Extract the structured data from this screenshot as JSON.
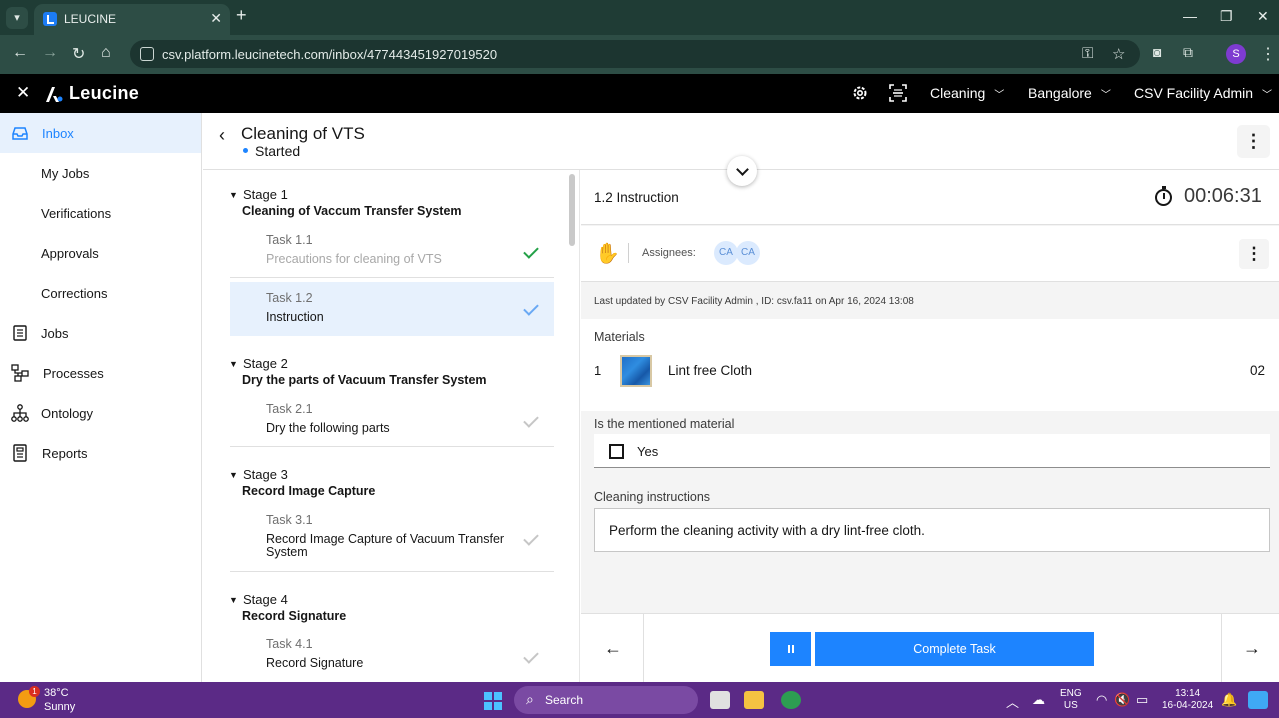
{
  "browser": {
    "tab_title": "LEUCINE",
    "url": "csv.platform.leucinetech.com/inbox/477443451927019520",
    "profile_initial": "S"
  },
  "app": {
    "logo_text": "Leucine",
    "dropdowns": {
      "use_case": "Cleaning",
      "facility": "Bangalore",
      "role": "CSV Facility Admin"
    },
    "icons": [
      "settings-icon",
      "scan-icon"
    ]
  },
  "sidebar": {
    "items": [
      {
        "label": "Inbox",
        "icon": "inbox-icon",
        "active": true
      },
      {
        "label": "My Jobs"
      },
      {
        "label": "Verifications"
      },
      {
        "label": "Approvals"
      },
      {
        "label": "Corrections"
      },
      {
        "label": "Jobs",
        "icon": "jobs-icon"
      },
      {
        "label": "Processes",
        "icon": "processes-icon"
      },
      {
        "label": "Ontology",
        "icon": "ontology-icon"
      },
      {
        "label": "Reports",
        "icon": "reports-icon"
      }
    ]
  },
  "job": {
    "title": "Cleaning of VTS",
    "status": "Started"
  },
  "stages": [
    {
      "label": "Stage 1",
      "name": "Cleaning of Vaccum Transfer System",
      "tasks": [
        {
          "label": "Task 1.1",
          "name": "Precautions for cleaning of VTS",
          "state": "done"
        },
        {
          "label": "Task 1.2",
          "name": "Instruction",
          "state": "active"
        }
      ]
    },
    {
      "label": "Stage 2",
      "name": "Dry the parts of Vacuum Transfer System",
      "tasks": [
        {
          "label": "Task 2.1",
          "name": "Dry the following parts",
          "state": "pending"
        }
      ]
    },
    {
      "label": "Stage 3",
      "name": "Record Image Capture",
      "tasks": [
        {
          "label": "Task 3.1",
          "name": "Record Image Capture of Vacuum Transfer System",
          "state": "pending"
        }
      ]
    },
    {
      "label": "Stage 4",
      "name": "Record Signature",
      "tasks": [
        {
          "label": "Task 4.1",
          "name": "Record Signature",
          "state": "pending"
        }
      ]
    }
  ],
  "task_detail": {
    "title": "1.2 Instruction",
    "timer": "00:06:31",
    "assignees_label": "Assignees:",
    "assignees": [
      "CA",
      "CA"
    ],
    "last_updated": "Last updated by CSV Facility Admin , ID: csv.fa11 on Apr 16, 2024 13:08",
    "materials_label": "Materials",
    "materials": [
      {
        "index": "1",
        "name": "Lint free Cloth",
        "quantity": "02"
      }
    ],
    "question": "Is the mentioned material",
    "option": {
      "label": "Yes",
      "checked": false
    },
    "instructions_label": "Cleaning instructions",
    "instructions_text": "Perform the cleaning activity with a dry lint-free cloth.",
    "complete_button": "Complete Task"
  },
  "taskbar": {
    "temperature": "38°C",
    "weather": "Sunny",
    "weather_badge": "1",
    "search_label": "Search",
    "language": "ENG",
    "region": "US",
    "time": "13:14",
    "date": "16-04-2024"
  },
  "colors": {
    "accent": "#1d84ff",
    "browser_chrome": "#2d4d45",
    "appbar": "#000000",
    "taskbar": "#5b2a86",
    "success": "#24a148"
  }
}
